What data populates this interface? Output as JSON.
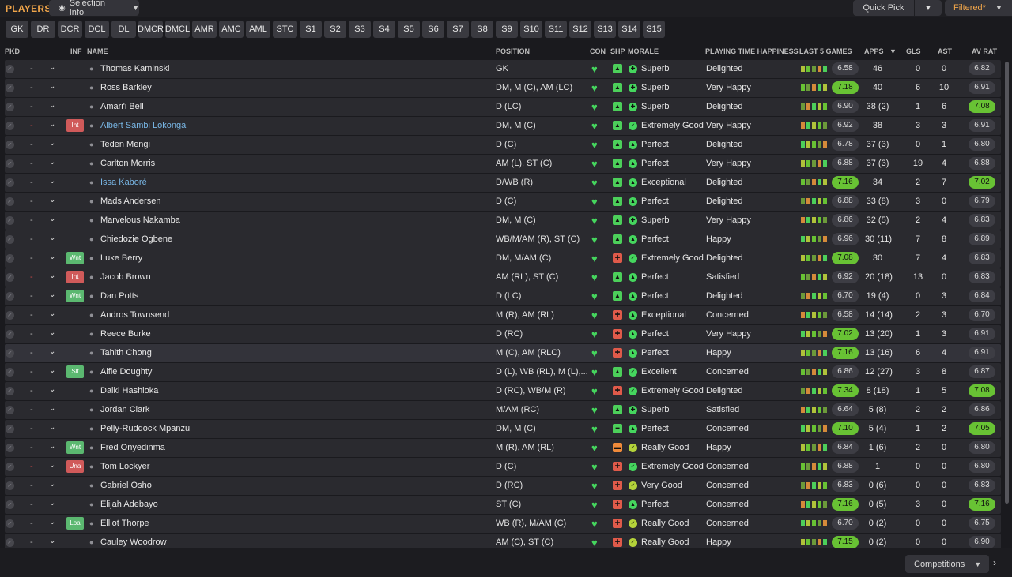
{
  "header": {
    "title": "PLAYERS",
    "selection_info": "Selection Info",
    "quick_pick": "Quick Pick",
    "filtered": "Filtered*"
  },
  "positions": [
    "GK",
    "DR",
    "DCR",
    "DCL",
    "DL",
    "DMCR",
    "DMCL",
    "AMR",
    "AMC",
    "AML",
    "STC",
    "S1",
    "S2",
    "S3",
    "S4",
    "S5",
    "S6",
    "S7",
    "S8",
    "S9",
    "S10",
    "S11",
    "S12",
    "S13",
    "S14",
    "S15"
  ],
  "columns": {
    "pkd": "PKD",
    "inf": "INF",
    "name": "NAME",
    "position": "POSITION",
    "con": "CON",
    "shp": "SHP",
    "morale": "MORALE",
    "pth": "PLAYING TIME HAPPINESS",
    "last5": "LAST 5 GAMES",
    "apps": "APPS",
    "gls": "GLS",
    "ast": "AST",
    "av_rat": "AV RAT"
  },
  "colors": {
    "accent": "#f0a54a",
    "link": "#79b7e6",
    "good": "#45d65e",
    "rating_good": "#68c234",
    "inf_red": "#d05a5a",
    "inf_green": "#5bb870"
  },
  "players": [
    {
      "name": "Thomas Kaminski",
      "inf": "",
      "position": "GK",
      "morale": "Superb",
      "pth": "Delighted",
      "last5": "6.58",
      "apps": "46",
      "gls": "0",
      "ast": "0",
      "av": "6.82",
      "con": "heart-icon",
      "shp": "sharp-icon"
    },
    {
      "name": "Ross Barkley",
      "inf": "",
      "position": "DM, M (C), AM (LC)",
      "morale": "Superb",
      "pth": "Very Happy",
      "last5": "7.18",
      "apps": "40",
      "gls": "6",
      "ast": "10",
      "av": "6.91",
      "con": "heart-icon",
      "shp": "sharp-icon"
    },
    {
      "name": "Amari'i Bell",
      "inf": "",
      "position": "D (LC)",
      "morale": "Superb",
      "pth": "Delighted",
      "last5": "6.90",
      "apps": "38 (2)",
      "gls": "1",
      "ast": "6",
      "av": "7.08",
      "con": "heart-icon",
      "shp": "sharp-icon"
    },
    {
      "name": "Albert Sambi Lokonga",
      "inf": "Int",
      "position": "DM, M (C)",
      "morale": "Extremely Good",
      "pth": "Very Happy",
      "last5": "6.92",
      "apps": "38",
      "gls": "3",
      "ast": "3",
      "av": "6.91",
      "con": "heart-icon",
      "shp": "sharp-icon"
    },
    {
      "name": "Teden Mengi",
      "inf": "",
      "position": "D (C)",
      "morale": "Perfect",
      "pth": "Delighted",
      "last5": "6.78",
      "apps": "37 (3)",
      "gls": "0",
      "ast": "1",
      "av": "6.80",
      "con": "heart-icon",
      "shp": "sharp-icon"
    },
    {
      "name": "Carlton Morris",
      "inf": "",
      "position": "AM (L), ST (C)",
      "morale": "Perfect",
      "pth": "Very Happy",
      "last5": "6.88",
      "apps": "37 (3)",
      "gls": "19",
      "ast": "4",
      "av": "6.88",
      "con": "heart-icon",
      "shp": "sharp-icon"
    },
    {
      "name": "Issa Kaboré",
      "inf": "",
      "position": "D/WB (R)",
      "morale": "Exceptional",
      "pth": "Delighted",
      "last5": "7.16",
      "apps": "34",
      "gls": "2",
      "ast": "7",
      "av": "7.02",
      "con": "heart-icon",
      "shp": "sharp-icon"
    },
    {
      "name": "Mads Andersen",
      "inf": "",
      "position": "D (C)",
      "morale": "Perfect",
      "pth": "Delighted",
      "last5": "6.88",
      "apps": "33 (8)",
      "gls": "3",
      "ast": "0",
      "av": "6.79",
      "con": "heart-icon",
      "shp": "sharp-icon"
    },
    {
      "name": "Marvelous Nakamba",
      "inf": "",
      "position": "DM, M (C)",
      "morale": "Superb",
      "pth": "Very Happy",
      "last5": "6.86",
      "apps": "32 (5)",
      "gls": "2",
      "ast": "4",
      "av": "6.83",
      "con": "heart-icon",
      "shp": "sharp-icon"
    },
    {
      "name": "Chiedozie Ogbene",
      "inf": "",
      "position": "WB/M/AM (R), ST (C)",
      "morale": "Perfect",
      "pth": "Happy",
      "last5": "6.96",
      "apps": "30 (11)",
      "gls": "7",
      "ast": "8",
      "av": "6.89",
      "con": "heart-icon",
      "shp": "sharp-icon"
    },
    {
      "name": "Luke Berry",
      "inf": "Wnt",
      "position": "DM, M/AM (C)",
      "morale": "Extremely Good",
      "pth": "Delighted",
      "last5": "7.08",
      "apps": "30",
      "gls": "7",
      "ast": "4",
      "av": "6.83",
      "con": "heart-icon",
      "shp": "unfit-icon"
    },
    {
      "name": "Jacob Brown",
      "inf": "Int",
      "position": "AM (RL), ST (C)",
      "morale": "Perfect",
      "pth": "Satisfied",
      "last5": "6.92",
      "apps": "20 (18)",
      "gls": "13",
      "ast": "0",
      "av": "6.83",
      "con": "heart-icon",
      "shp": "sharp-icon"
    },
    {
      "name": "Dan Potts",
      "inf": "Wnt",
      "position": "D (LC)",
      "morale": "Perfect",
      "pth": "Delighted",
      "last5": "6.70",
      "apps": "19 (4)",
      "gls": "0",
      "ast": "3",
      "av": "6.84",
      "con": "heart-icon",
      "shp": "sharp-icon"
    },
    {
      "name": "Andros Townsend",
      "inf": "",
      "position": "M (R), AM (RL)",
      "morale": "Exceptional",
      "pth": "Concerned",
      "last5": "6.58",
      "apps": "14 (14)",
      "gls": "2",
      "ast": "3",
      "av": "6.70",
      "con": "heart-icon",
      "shp": "unfit-icon"
    },
    {
      "name": "Reece Burke",
      "inf": "",
      "position": "D (RC)",
      "morale": "Perfect",
      "pth": "Very Happy",
      "last5": "7.02",
      "apps": "13 (20)",
      "gls": "1",
      "ast": "3",
      "av": "6.91",
      "con": "heart-icon",
      "shp": "unfit-icon"
    },
    {
      "name": "Tahith Chong",
      "inf": "",
      "position": "M (C), AM (RLC)",
      "morale": "Perfect",
      "pth": "Happy",
      "last5": "7.16",
      "apps": "13 (16)",
      "gls": "6",
      "ast": "4",
      "av": "6.91",
      "con": "heart-icon",
      "shp": "unfit-icon"
    },
    {
      "name": "Alfie Doughty",
      "inf": "Slt",
      "position": "D (L), WB (RL), M (L),...",
      "morale": "Excellent",
      "pth": "Concerned",
      "last5": "6.86",
      "apps": "12 (27)",
      "gls": "3",
      "ast": "8",
      "av": "6.87",
      "con": "heart-icon",
      "shp": "sharp-icon"
    },
    {
      "name": "Daiki Hashioka",
      "inf": "",
      "position": "D (RC), WB/M (R)",
      "morale": "Extremely Good",
      "pth": "Delighted",
      "last5": "7.34",
      "apps": "8 (18)",
      "gls": "1",
      "ast": "5",
      "av": "7.08",
      "con": "heart-icon",
      "shp": "unfit-icon"
    },
    {
      "name": "Jordan Clark",
      "inf": "",
      "position": "M/AM (RC)",
      "morale": "Superb",
      "pth": "Satisfied",
      "last5": "6.64",
      "apps": "5 (8)",
      "gls": "2",
      "ast": "2",
      "av": "6.86",
      "con": "heart-icon",
      "shp": "sharp-icon"
    },
    {
      "name": "Pelly-Ruddock Mpanzu",
      "inf": "",
      "position": "DM, M (C)",
      "morale": "Perfect",
      "pth": "Concerned",
      "last5": "7.10",
      "apps": "5 (4)",
      "gls": "1",
      "ast": "2",
      "av": "7.05",
      "con": "heart-icon",
      "shp": "match-fit-icon"
    },
    {
      "name": "Fred Onyedinma",
      "inf": "Wnt",
      "position": "M (R), AM (RL)",
      "morale": "Really Good",
      "pth": "Happy",
      "last5": "6.84",
      "apps": "1 (6)",
      "gls": "2",
      "ast": "0",
      "av": "6.80",
      "con": "heart-icon",
      "shp": "low-icon"
    },
    {
      "name": "Tom Lockyer",
      "inf": "Una",
      "position": "D (C)",
      "morale": "Extremely Good",
      "pth": "Concerned",
      "last5": "6.88",
      "apps": "1",
      "gls": "0",
      "ast": "0",
      "av": "6.80",
      "con": "heart-icon",
      "shp": "unfit-icon"
    },
    {
      "name": "Gabriel Osho",
      "inf": "",
      "position": "D (RC)",
      "morale": "Very Good",
      "pth": "Concerned",
      "last5": "6.83",
      "apps": "0 (6)",
      "gls": "0",
      "ast": "0",
      "av": "6.83",
      "con": "heart-icon",
      "shp": "unfit-icon"
    },
    {
      "name": "Elijah Adebayo",
      "inf": "",
      "position": "ST (C)",
      "morale": "Perfect",
      "pth": "Concerned",
      "last5": "7.16",
      "apps": "0 (5)",
      "gls": "3",
      "ast": "0",
      "av": "7.16",
      "con": "heart-icon",
      "shp": "unfit-icon"
    },
    {
      "name": "Elliot Thorpe",
      "inf": "Loa",
      "position": "WB (R), M/AM (C)",
      "morale": "Really Good",
      "pth": "Concerned",
      "last5": "6.70",
      "apps": "0 (2)",
      "gls": "0",
      "ast": "0",
      "av": "6.75",
      "con": "heart-icon",
      "shp": "unfit-icon"
    },
    {
      "name": "Cauley Woodrow",
      "inf": "",
      "position": "AM (C), ST (C)",
      "morale": "Really Good",
      "pth": "Happy",
      "last5": "7.15",
      "apps": "0 (2)",
      "gls": "0",
      "ast": "0",
      "av": "6.90",
      "con": "heart-icon",
      "shp": "unfit-icon"
    }
  ],
  "footer": {
    "competitions": "Competitions"
  }
}
